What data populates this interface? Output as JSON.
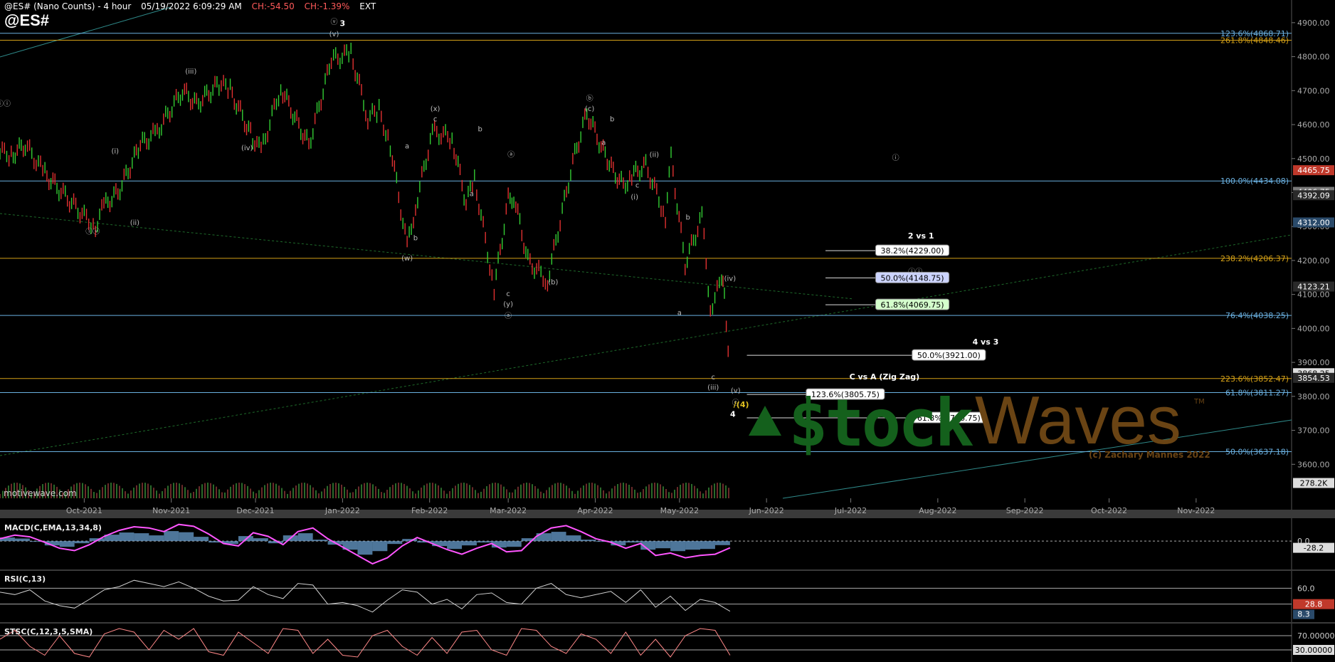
{
  "header": {
    "instrument": "@ES# (Nano Counts) - 4 hour",
    "datetime": "05/19/2022 6:09:29 AM",
    "change": "CH:-54.50",
    "change_pct": "CH:-1.39%",
    "session": "EXT",
    "symbol": "@ES#"
  },
  "watermark": "motivewave.com",
  "logo": {
    "part1": "$tock",
    "part2": "Waves",
    "tm": "TM",
    "copyright": "(c) Zachary Mannes 2022"
  },
  "colors": {
    "candle_up": "#33cc33",
    "candle_down": "#e03030",
    "fib_orange": "#d4a017",
    "fib_blue": "#6ab0e0",
    "macd": "#ff55ff",
    "macd_hist": "#6fa8dc",
    "rsi": "#cfcfcf",
    "stoch_k": "#ff8888"
  },
  "chart_data": [
    {
      "type": "line",
      "name": "price",
      "x": [
        "2021-09-01",
        "2021-09-05",
        "2021-09-10",
        "2021-09-17",
        "2021-09-22",
        "2021-10-01",
        "2021-10-05",
        "2021-10-08",
        "2021-10-13",
        "2021-10-21",
        "2021-10-27",
        "2021-11-05",
        "2021-11-10",
        "2021-11-18",
        "2021-11-22",
        "2021-11-30",
        "2021-12-03",
        "2021-12-10",
        "2021-12-15",
        "2021-12-20",
        "2021-12-28",
        "2022-01-04",
        "2022-01-10",
        "2022-01-14",
        "2022-01-18",
        "2022-01-24",
        "2022-01-27",
        "2022-02-02",
        "2022-02-09",
        "2022-02-14",
        "2022-02-17",
        "2022-02-24",
        "2022-03-01",
        "2022-03-03",
        "2022-03-08",
        "2022-03-15",
        "2022-03-24",
        "2022-03-29",
        "2022-04-06",
        "2022-04-11",
        "2022-04-14",
        "2022-04-19",
        "2022-04-26",
        "2022-04-28",
        "2022-05-03",
        "2022-05-09",
        "2022-05-12",
        "2022-05-16",
        "2022-05-17",
        "2022-05-19"
      ],
      "values": [
        4520,
        4510,
        4540,
        4455,
        4410,
        4330,
        4300,
        4360,
        4400,
        4540,
        4580,
        4700,
        4660,
        4720,
        4700,
        4560,
        4520,
        4710,
        4620,
        4540,
        4790,
        4810,
        4620,
        4640,
        4540,
        4240,
        4360,
        4580,
        4560,
        4370,
        4440,
        4115,
        4380,
        4390,
        4200,
        4140,
        4490,
        4635,
        4480,
        4420,
        4450,
        4480,
        4330,
        4500,
        4190,
        4330,
        4060,
        4140,
        4100,
        3868.25
      ],
      "ylim": [
        3500,
        4950
      ],
      "ytick_labels": [
        "3600.00",
        "3700.00",
        "3800.00",
        "3900.00",
        "4000.00",
        "4100.00",
        "4200.00",
        "4300.00",
        "4400.00",
        "4500.00",
        "4600.00",
        "4700.00",
        "4800.00",
        "4900.00"
      ],
      "ytick_values": [
        3600,
        3700,
        3800,
        3900,
        4000,
        4100,
        4200,
        4300,
        4400,
        4500,
        4600,
        4700,
        4800,
        4900
      ],
      "xtick_labels": [
        "Oct-2021",
        "Nov-2021",
        "Dec-2021",
        "Jan-2022",
        "Feb-2022",
        "Mar-2022",
        "Apr-2022",
        "May-2022",
        "Jun-2022",
        "Jul-2022",
        "Aug-2022",
        "Sep-2022",
        "Oct-2022",
        "Nov-2022"
      ],
      "xtick_dates": [
        "2021-10-01",
        "2021-11-01",
        "2021-12-01",
        "2022-01-01",
        "2022-02-01",
        "2022-03-01",
        "2022-04-01",
        "2022-05-01",
        "2022-06-01",
        "2022-07-01",
        "2022-08-01",
        "2022-09-01",
        "2022-10-01",
        "2022-11-01"
      ],
      "xlim": [
        "2021-09-01",
        "2022-12-05"
      ],
      "price_badges": [
        {
          "label": "4465.75",
          "value": 4465.75,
          "color": "#c0392b"
        },
        {
          "label": "4406.75",
          "value": 4402,
          "color": "#7a7a7a"
        },
        {
          "label": "4392.09",
          "value": 4392.09,
          "color": "#2a2a2a"
        },
        {
          "label": "4312.00",
          "value": 4312,
          "color": "#2a4a6a"
        },
        {
          "label": "4123.21",
          "value": 4123.21,
          "color": "#2a2a2a"
        },
        {
          "label": "3868.25",
          "value": 3868.25,
          "color": "#dddddd"
        },
        {
          "label": "3854.53",
          "value": 3854.53,
          "color": "#2a2a2a"
        },
        {
          "label": "278.2K",
          "value": 3545,
          "color": "#dddddd"
        }
      ],
      "fib_levels": [
        {
          "label": "123.6%(4868.71)",
          "value": 4868.71,
          "color": "#6ab0e0"
        },
        {
          "label": "261.8%(4848.46)",
          "value": 4848.46,
          "color": "#d4a017"
        },
        {
          "label": "100.0%(4434.08)",
          "value": 4434.08,
          "color": "#6ab0e0"
        },
        {
          "label": "238.2%(4206.37)",
          "value": 4206.37,
          "color": "#d4a017"
        },
        {
          "label": "76.4%(4038.25)",
          "value": 4038.25,
          "color": "#6ab0e0"
        },
        {
          "label": "223.6%(3852.47)",
          "value": 3852.47,
          "color": "#d4a017"
        },
        {
          "label": "61.8%(3811.27)",
          "value": 3811.27,
          "color": "#6ab0e0"
        },
        {
          "label": "50.0%(3637.18)",
          "value": 3637.18,
          "color": "#6ab0e0"
        }
      ],
      "target_boxes": [
        {
          "label": "38.2%(4229.00)",
          "value": 4229,
          "x0": "2022-06-22",
          "x1": "2022-08-05",
          "fill": "#ffffff"
        },
        {
          "label": "50.0%(4148.75)",
          "value": 4148.75,
          "x0": "2022-06-22",
          "x1": "2022-08-05",
          "fill": "#ccd4ff"
        },
        {
          "label": "61.8%(4069.75)",
          "value": 4069.75,
          "x0": "2022-06-22",
          "x1": "2022-08-05",
          "fill": "#d4ffcc"
        },
        {
          "label": "50.0%(3921.00)",
          "value": 3921,
          "x0": "2022-05-25",
          "x1": "2022-08-18",
          "fill": "#ffffff"
        },
        {
          "label": "123.6%(3805.75)",
          "value": 3805.75,
          "x0": "2022-05-25",
          "x1": "2022-07-13",
          "fill": "#ffffff"
        },
        {
          "label": "61.8%(3736.75)",
          "value": 3736.75,
          "x0": "2022-05-25",
          "x1": "2022-08-18",
          "fill": "#ffffff"
        }
      ],
      "annotations": [
        {
          "text": "2 vs 1",
          "x": "2022-07-26",
          "y": 4265,
          "color": "#ffffff"
        },
        {
          "text": "4 vs 3",
          "x": "2022-08-18",
          "y": 3953,
          "color": "#ffffff"
        },
        {
          "text": "C vs A (Zig Zag)",
          "x": "2022-07-13",
          "y": 3850,
          "color": "#ffffff"
        },
        {
          "text": "3",
          "x": "2022-01-01",
          "y": 4890,
          "color": "#ffffff"
        },
        {
          "text": "4",
          "x": "2022-05-20",
          "y": 3740,
          "color": "#ffffff"
        },
        {
          "text": "/(4)",
          "x": "2022-05-23",
          "y": 3768,
          "color": "#e0c020"
        }
      ],
      "wave_labels": [
        {
          "t": "(iii)",
          "x": "2021-11-08",
          "y": 4750
        },
        {
          "t": "(iv)",
          "x": "2021-11-28",
          "y": 4525
        },
        {
          "t": "(v)",
          "x": "2021-12-29",
          "y": 4860
        },
        {
          "t": "ⓥ",
          "x": "2021-12-29",
          "y": 4895
        },
        {
          "t": "ⓘⓥ",
          "x": "2021-10-04",
          "y": 4278
        },
        {
          "t": "(i)",
          "x": "2021-10-12",
          "y": 4515
        },
        {
          "t": "(ii)",
          "x": "2021-10-19",
          "y": 4305
        },
        {
          "t": "ⓘⓘⓘ",
          "x": "2021-09-01",
          "y": 4655
        },
        {
          "t": "(w)",
          "x": "2022-01-24",
          "y": 4200
        },
        {
          "t": "a",
          "x": "2022-01-24",
          "y": 4530
        },
        {
          "t": "b",
          "x": "2022-01-27",
          "y": 4260
        },
        {
          "t": "(x)",
          "x": "2022-02-03",
          "y": 4640
        },
        {
          "t": "c",
          "x": "2022-02-03",
          "y": 4610
        },
        {
          "t": "b",
          "x": "2022-02-19",
          "y": 4580
        },
        {
          "t": "a",
          "x": "2022-02-16",
          "y": 4390
        },
        {
          "t": "ⓐ",
          "x": "2022-03-02",
          "y": 4505
        },
        {
          "t": "c",
          "x": "2022-03-01",
          "y": 4095
        },
        {
          "t": "(y)",
          "x": "2022-03-01",
          "y": 4065
        },
        {
          "t": "ⓐ",
          "x": "2022-03-01",
          "y": 4030
        },
        {
          "t": "(b)",
          "x": "2022-03-17",
          "y": 4130
        },
        {
          "t": "ⓑ",
          "x": "2022-03-30",
          "y": 4670
        },
        {
          "t": "(c)",
          "x": "2022-03-30",
          "y": 4640
        },
        {
          "t": "b",
          "x": "2022-04-07",
          "y": 4610
        },
        {
          "t": "a",
          "x": "2022-04-04",
          "y": 4540
        },
        {
          "t": "(ii)",
          "x": "2022-04-22",
          "y": 4505
        },
        {
          "t": "c",
          "x": "2022-04-16",
          "y": 4415
        },
        {
          "t": "(i)",
          "x": "2022-04-15",
          "y": 4380
        },
        {
          "t": "b",
          "x": "2022-05-04",
          "y": 4320
        },
        {
          "t": "a",
          "x": "2022-05-01",
          "y": 4040
        },
        {
          "t": "(iv)",
          "x": "2022-05-19",
          "y": 4140
        },
        {
          "t": "c",
          "x": "2022-05-13",
          "y": 3850
        },
        {
          "t": "(iii)",
          "x": "2022-05-13",
          "y": 3820
        },
        {
          "t": "(v)",
          "x": "2022-05-21",
          "y": 3810
        },
        {
          "t": "ⓒ",
          "x": "2022-05-21",
          "y": 3775
        },
        {
          "t": "ⓘ",
          "x": "2022-07-17",
          "y": 4495
        },
        {
          "t": "ⓘⓘ",
          "x": "2022-07-24",
          "y": 4160
        }
      ]
    },
    {
      "type": "line",
      "name": "MACD(C,EMA,13,34,8)",
      "title": "MACD(C,EMA,13,34,8)",
      "values": [
        10,
        25,
        18,
        -5,
        -30,
        -40,
        -15,
        20,
        45,
        60,
        55,
        40,
        70,
        62,
        30,
        -10,
        -20,
        35,
        20,
        -15,
        40,
        55,
        10,
        -25,
        -60,
        -95,
        -70,
        -20,
        15,
        -10,
        -35,
        -55,
        -30,
        -10,
        -45,
        -40,
        20,
        55,
        65,
        40,
        10,
        -5,
        -30,
        -10,
        -60,
        -50,
        -70,
        -60,
        -55,
        -28.2
      ],
      "ylim": [
        -110,
        90
      ],
      "tick_label": "0.0",
      "last_label": "-28.2"
    },
    {
      "type": "line",
      "name": "RSI(C,13)",
      "title": "RSI(C,13)",
      "values": [
        55,
        52,
        58,
        44,
        38,
        35,
        46,
        58,
        62,
        70,
        66,
        62,
        68,
        60,
        50,
        44,
        45,
        62,
        52,
        47,
        66,
        64,
        40,
        42,
        38,
        30,
        45,
        58,
        55,
        40,
        46,
        34,
        52,
        54,
        42,
        40,
        60,
        66,
        52,
        48,
        52,
        56,
        42,
        58,
        36,
        50,
        32,
        46,
        42,
        31
      ],
      "ylim": [
        20,
        80
      ],
      "tick_label": "60.0",
      "last_label": "28.8",
      "badge2": "8.3"
    },
    {
      "type": "line",
      "name": "STSC(C,12,3,5,SMA)",
      "title": "STSC(C,12,3,5,SMA)",
      "values": [
        60,
        85,
        40,
        15,
        70,
        20,
        10,
        75,
        90,
        80,
        30,
        85,
        60,
        90,
        25,
        15,
        80,
        50,
        20,
        90,
        85,
        20,
        60,
        15,
        10,
        70,
        85,
        40,
        15,
        65,
        20,
        80,
        85,
        30,
        15,
        90,
        85,
        40,
        20,
        75,
        60,
        20,
        80,
        15,
        60,
        10,
        70,
        90,
        85,
        15
      ],
      "ylim": [
        0,
        100
      ],
      "tick_label": "70.00000",
      "last_label": "30.00000"
    }
  ]
}
